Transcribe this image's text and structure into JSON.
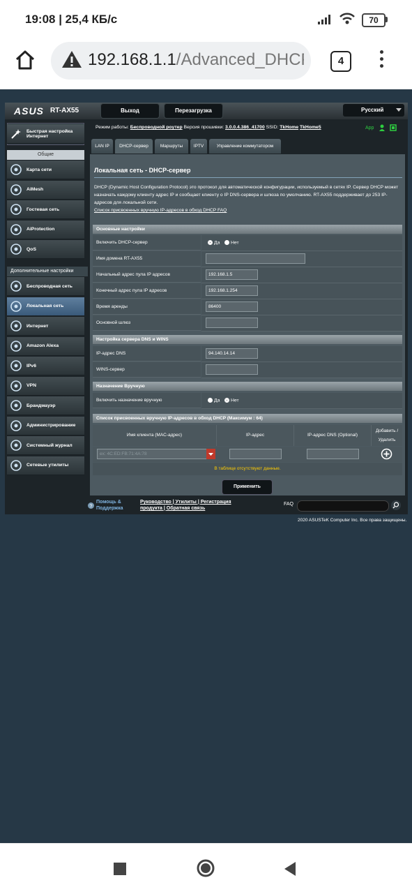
{
  "status_bar": {
    "time_speed": "19:08 | 25,4 КБ/с",
    "battery": "70"
  },
  "browser": {
    "url_host": "192.168.1.1",
    "url_path": "/Advanced_DHCP",
    "tab_count": "4"
  },
  "router": {
    "brand": "ASUS",
    "model": "RT-AX55",
    "logout_label": "Выход",
    "reboot_label": "Перезагрузка",
    "language": "Русский",
    "info": {
      "mode_label": "Режим работы:",
      "mode_value": "Беспроводной роутер",
      "fw_label": "Версия прошивки:",
      "fw_value": "3.0.0.4.386_41700",
      "ssid_label": "SSID:",
      "ssid_1": "TkHome",
      "ssid_2": "TkHome5",
      "app_label": "App"
    }
  },
  "sidebar": {
    "quick_setup": "Быстрая настройка Интернет",
    "general_header": "Общие",
    "general": [
      {
        "label": "Карта сети",
        "icon": "network-map-icon"
      },
      {
        "label": "AiMesh",
        "icon": "aimesh-icon"
      },
      {
        "label": "Гостевая сеть",
        "icon": "guest-network-icon"
      },
      {
        "label": "AiProtection",
        "icon": "aiprotection-icon"
      },
      {
        "label": "QoS",
        "icon": "qos-icon"
      }
    ],
    "advanced_header": "Дополнительные настройки",
    "advanced": [
      {
        "label": "Беспроводная сеть",
        "icon": "wireless-icon"
      },
      {
        "label": "Локальная сеть",
        "icon": "lan-icon",
        "active": true
      },
      {
        "label": "Интернет",
        "icon": "globe-icon"
      },
      {
        "label": "Amazon Alexa",
        "icon": "alexa-icon"
      },
      {
        "label": "IPv6",
        "icon": "ipv6-icon"
      },
      {
        "label": "VPN",
        "icon": "vpn-icon"
      },
      {
        "label": "Брандмауэр",
        "icon": "firewall-icon"
      },
      {
        "label": "Администрирование",
        "icon": "admin-icon"
      },
      {
        "label": "Системный журнал",
        "icon": "syslog-icon"
      },
      {
        "label": "Сетевые утилиты",
        "icon": "network-tools-icon"
      }
    ]
  },
  "tabs": [
    "LAN IP",
    "DHCP-сервер",
    "Маршруты",
    "IPTV",
    "Управление коммутатором"
  ],
  "main": {
    "title": "Локальная сеть - DHCP-сервер",
    "description": "DHCP (Dynamic Host Configuration Protocol) это протокол для автоматической конфигурации, используемый в сетях IP. Сервер DHCP может назначать каждому клиенту адрес IP и сообщает клиенту о IP DNS-сервера и шлюза по умолчанию. RT-AX55 поддерживает до 253 IP-адресов для локальной сети.",
    "faq_link": "Список присвоенных вручную IP-адресов в обход DHCP FAQ",
    "basic_header": "Основные настройки",
    "enable_dhcp_label": "Включить DHCP-сервер",
    "yes": "Да",
    "no": "Нет",
    "domain_label": "Имя домена RT-AX55",
    "start_label": "Начальный адрес пула IP адресов",
    "start_value": "192.168.1.5",
    "end_label": "Конечный адрес пула IP адресов",
    "end_value": "192.168.1.254",
    "lease_label": "Время аренды",
    "lease_value": "86400",
    "gateway_label": "Основной шлюз",
    "dns_header": "Настройка сервера DNS и WINS",
    "dns_label": "IP-адрес DNS",
    "dns_value": "94.140.14.14",
    "wins_label": "WINS-сервер",
    "manual_header": "Назначение Вручную",
    "manual_enable_label": "Включить назначение вручную",
    "list_header": "Список присвоенных вручную IP-адресов в обход DHCP (Максимум : 64)",
    "col_client": "Имя клиента (MAC-адрес)",
    "col_ip": "IP-адрес",
    "col_dns": "IP-адрес DNS (Optional)",
    "col_add": "Добавить / Удалить",
    "client_placeholder": "ex: 4C:ED:FB:71:4A:78",
    "empty_text": "В таблице отсутствуют данные.",
    "apply_label": "Применить"
  },
  "footer": {
    "help": "Помощь & Поддержка",
    "manual": "Руководство",
    "utils": "Утилиты",
    "register": "Регистрация продукта",
    "feedback": "Обратная связь",
    "faq": "FAQ",
    "copyright": "2020 ASUSTeK Computer Inc. Все права защищены."
  }
}
